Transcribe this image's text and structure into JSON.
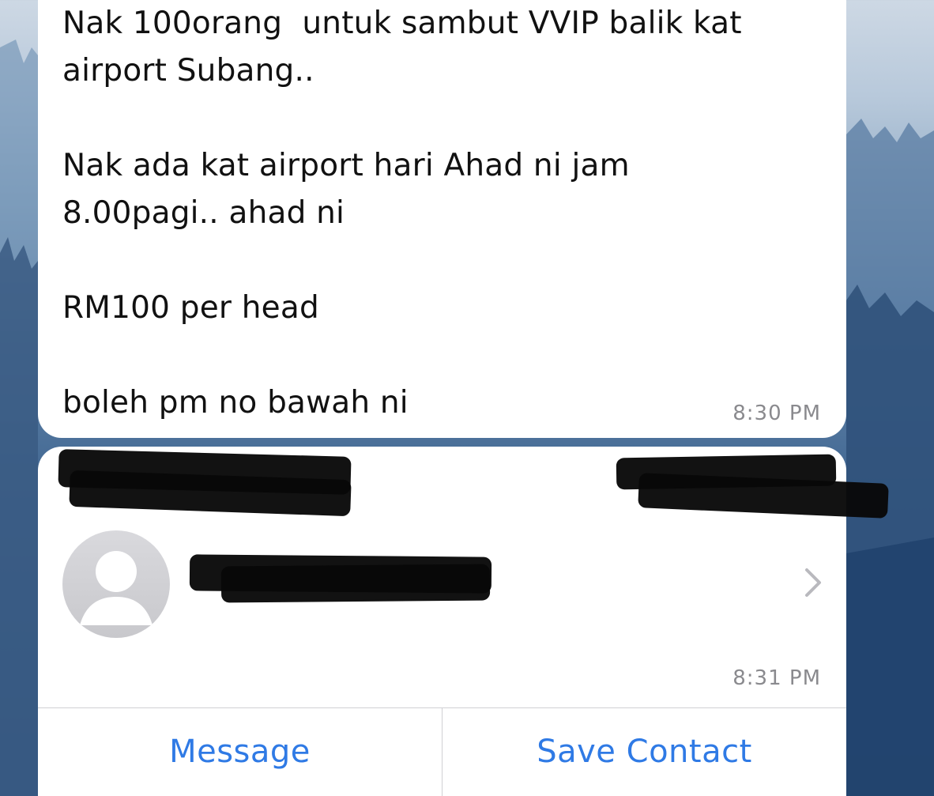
{
  "message": {
    "text": "Nak 100orang  untuk sambut VVIP balik kat\nairport Subang..\n\nNak ada kat airport hari Ahad ni jam\n8.00pagi.. ahad ni\n\nRM100 per head\n\nboleh pm no bawah ni",
    "time": "8:30 PM"
  },
  "contact_card": {
    "time": "8:31 PM",
    "buttons": {
      "message_label": "Message",
      "save_contact_label": "Save Contact"
    },
    "avatar_icon": "person-placeholder-icon",
    "chevron_icon": "chevron-right-icon"
  },
  "colors": {
    "action_blue": "#2f7ae5",
    "timestamp_gray": "#8a8a8e",
    "bubble_white": "#ffffff"
  }
}
